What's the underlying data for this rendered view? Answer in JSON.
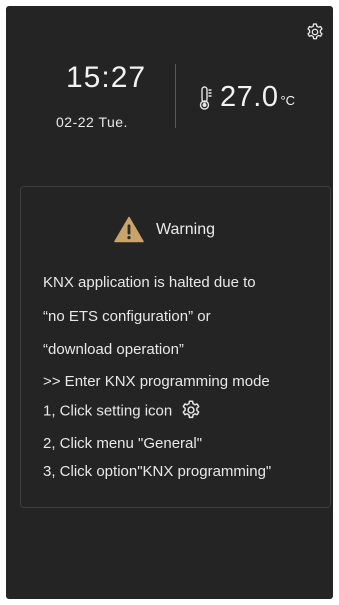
{
  "header": {
    "time": "15:27",
    "date": "02-22  Tue.",
    "temperature": "27.0",
    "temperature_unit": "°C",
    "settings_icon": "gear-icon",
    "thermometer_icon": "thermometer-icon"
  },
  "warning": {
    "icon": "warning-icon",
    "title": "Warning",
    "lines": [
      "KNX application is halted due to",
      "“no ETS configuration”   or",
      "“download operation”",
      ">> Enter KNX programming mode",
      "1, Click setting icon",
      "2, Click menu \"General\"",
      "3, Click option\"KNX programming\""
    ]
  },
  "colors": {
    "background": "#252425",
    "text": "#eaeaea",
    "warning_fill": "#c9a36a",
    "card_border": "#3e3e3e"
  }
}
